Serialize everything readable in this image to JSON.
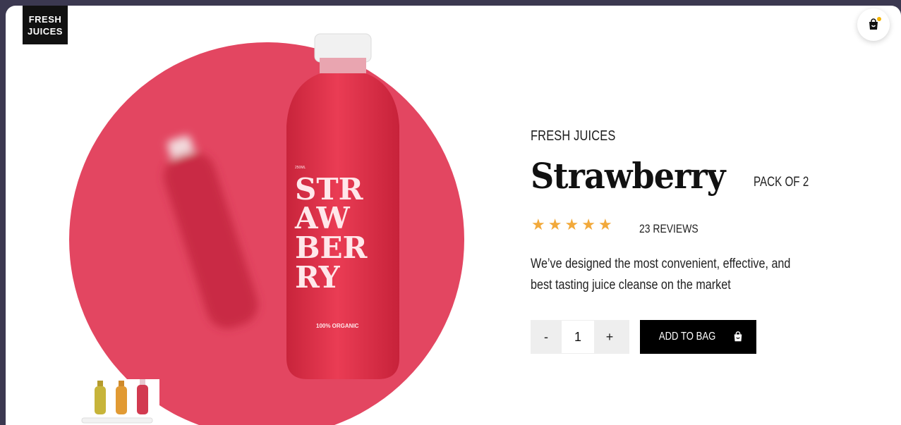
{
  "brand": {
    "logo_line1": "FRESH",
    "logo_line2": "JUICES"
  },
  "product": {
    "category": "FRESH JUICES",
    "name": "Strawberry",
    "pack": "PACK OF 2",
    "rating": 5,
    "reviews": "23 REVIEWS",
    "description": "We’ve designed the most convenient, effective, and best tasting juice cleanse on the market",
    "bottle_label_lines": [
      "STR",
      "AW",
      "BER",
      "RY"
    ],
    "bottle_small_text": "100% ORGANIC"
  },
  "cart": {
    "quantity": "1",
    "minus_label": "-",
    "plus_label": "+",
    "add_label": "ADD TO BAG"
  },
  "icons": {
    "cart": "shopping-bag-icon",
    "star": "star-icon"
  },
  "colors": {
    "accent": "#e34661",
    "star": "#f2a93b",
    "button": "#000000"
  }
}
